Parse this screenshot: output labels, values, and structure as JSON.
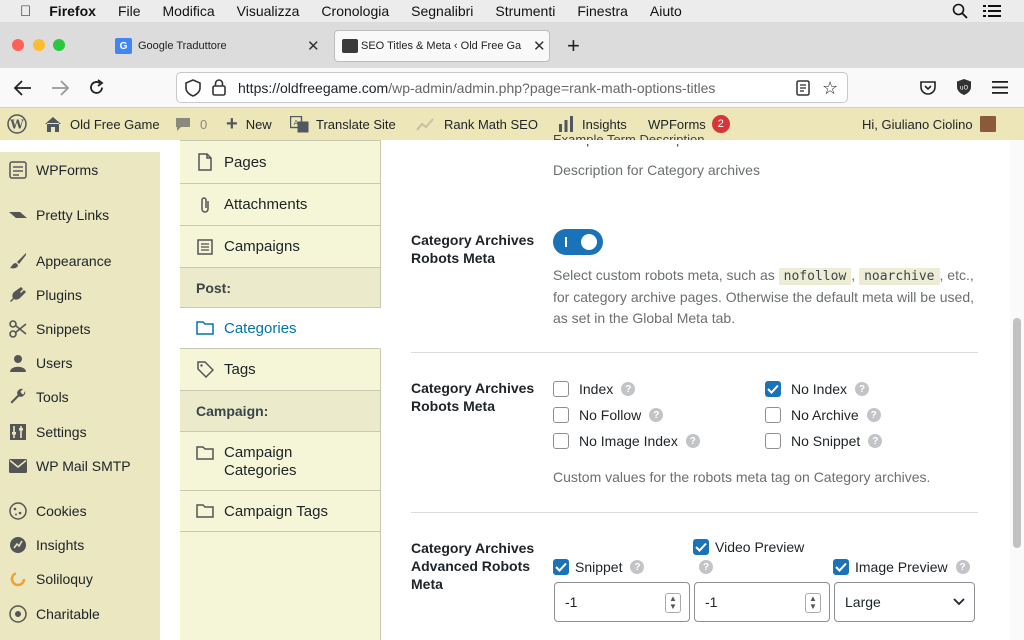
{
  "macos": {
    "app": "Firefox",
    "menus": [
      "File",
      "Modifica",
      "Visualizza",
      "Cronologia",
      "Segnalibri",
      "Strumenti",
      "Finestra",
      "Aiuto"
    ]
  },
  "tabs": [
    {
      "title": "Google Traduttore",
      "favicon": "google-translate-icon"
    },
    {
      "title": "SEO Titles & Meta ‹ Old Free Ga",
      "favicon": "site-favicon"
    }
  ],
  "nav": {
    "url_domain": "https://oldfreegame.com",
    "url_path": "/wp-admin/admin.php?page=rank-math-options-titles"
  },
  "adminbar": {
    "site": "Old Free Game",
    "comments": "0",
    "new": "New",
    "translate": "Translate Site",
    "rankmath": "Rank Math SEO",
    "insights": "Insights",
    "wpforms": "WPForms",
    "wpforms_badge": "2",
    "greeting": "Hi, Giuliano Ciolino"
  },
  "sidebar": {
    "items": [
      {
        "label": "WPForms",
        "icon": "wpforms-icon"
      },
      {
        "label": "Pretty Links",
        "icon": "pretty-links-icon"
      },
      {
        "label": "Appearance",
        "icon": "paintbrush-icon"
      },
      {
        "label": "Plugins",
        "icon": "plugin-icon"
      },
      {
        "label": "Snippets",
        "icon": "scissors-icon"
      },
      {
        "label": "Users",
        "icon": "user-icon"
      },
      {
        "label": "Tools",
        "icon": "wrench-icon"
      },
      {
        "label": "Settings",
        "icon": "settings-icon"
      },
      {
        "label": "WP Mail SMTP",
        "icon": "mail-icon"
      },
      {
        "label": "Cookies",
        "icon": "cookie-icon"
      },
      {
        "label": "Insights",
        "icon": "insights-icon"
      },
      {
        "label": "Soliloquy",
        "icon": "soliloquy-icon"
      },
      {
        "label": "Charitable",
        "icon": "charitable-icon"
      }
    ]
  },
  "vtabs": {
    "pages": "Pages",
    "attachments": "Attachments",
    "campaigns": "Campaigns",
    "post_header": "Post:",
    "categories": "Categories",
    "tags": "Tags",
    "campaign_header": "Campaign:",
    "campaign_categories": "Campaign Categories",
    "campaign_tags": "Campaign Tags"
  },
  "main": {
    "top_partial": "Example Term Description",
    "desc_top": "Description for Category archives",
    "robots_toggle": {
      "label": "Category Archives Robots Meta",
      "desc_pre": "Select custom robots meta, such as",
      "code1": "nofollow",
      "code2": "noarchive",
      "desc_post": "etc., for category archive pages. Otherwise the default meta will be used, as set in the Global Meta tab."
    },
    "robots_meta": {
      "label": "Category Archives Robots Meta",
      "options": [
        {
          "label": "Index",
          "checked": false
        },
        {
          "label": "No Index",
          "checked": true
        },
        {
          "label": "No Follow",
          "checked": false
        },
        {
          "label": "No Archive",
          "checked": false
        },
        {
          "label": "No Image Index",
          "checked": false
        },
        {
          "label": "No Snippet",
          "checked": false
        }
      ],
      "desc": "Custom values for the robots meta tag on Category archives."
    },
    "advanced": {
      "label": "Category Archives Advanced Robots Meta",
      "snippet": {
        "label": "Snippet",
        "checked": true,
        "value": "-1"
      },
      "video": {
        "label": "Video Preview",
        "checked": true,
        "value": "-1"
      },
      "image": {
        "label": "Image Preview",
        "checked": true,
        "value": "Large"
      }
    }
  },
  "colors": {
    "accent": "#0073aa",
    "toggle": "#1a73b8",
    "badge": "#d63638"
  }
}
